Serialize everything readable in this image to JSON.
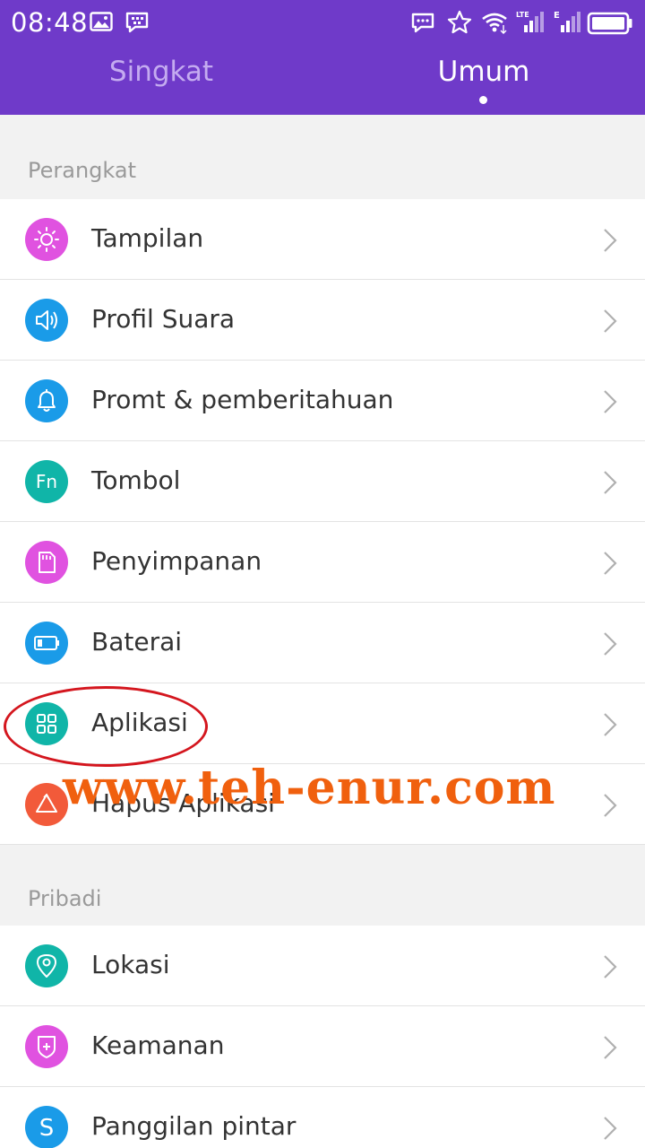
{
  "status_bar": {
    "time": "08:48",
    "left_icons": [
      "image-icon",
      "bbm-icon"
    ],
    "right_icons": [
      "message-icon",
      "star-icon",
      "wifi-icon",
      "signal-lte-icon",
      "signal-e-icon",
      "battery-icon"
    ],
    "lte_label": "LTE",
    "e_label": "E"
  },
  "tabs": [
    {
      "label": "Singkat",
      "active": false
    },
    {
      "label": "Umum",
      "active": true
    }
  ],
  "sections": [
    {
      "title": "Perangkat",
      "items": [
        {
          "label": "Tampilan",
          "icon": "brightness-icon",
          "color": "#e052e0"
        },
        {
          "label": "Profil Suara",
          "icon": "speaker-icon",
          "color": "#1a9be8"
        },
        {
          "label": "Promt & pemberitahuan",
          "icon": "bell-icon",
          "color": "#1a9be8"
        },
        {
          "label": "Tombol",
          "icon": "fn-icon",
          "icon_text": "Fn",
          "color": "#10b5a8"
        },
        {
          "label": "Penyimpanan",
          "icon": "sd-card-icon",
          "color": "#e052e0"
        },
        {
          "label": "Baterai",
          "icon": "battery-icon",
          "color": "#1a9be8"
        },
        {
          "label": "Aplikasi",
          "icon": "apps-grid-icon",
          "color": "#10b5a8"
        },
        {
          "label": "Hapus Aplikasi",
          "icon": "recycle-icon",
          "color": "#f25a3a"
        }
      ]
    },
    {
      "title": "Pribadi",
      "items": [
        {
          "label": "Lokasi",
          "icon": "location-pin-icon",
          "color": "#10b5a8"
        },
        {
          "label": "Keamanan",
          "icon": "shield-icon",
          "color": "#e052e0"
        },
        {
          "label": "Panggilan pintar",
          "icon": "smart-call-icon",
          "icon_text": "S",
          "color": "#1a9be8"
        }
      ]
    }
  ],
  "watermark": "www.teh-enur.com",
  "annotation": {
    "highlighted_item": "Aplikasi",
    "color": "#d4161e"
  }
}
